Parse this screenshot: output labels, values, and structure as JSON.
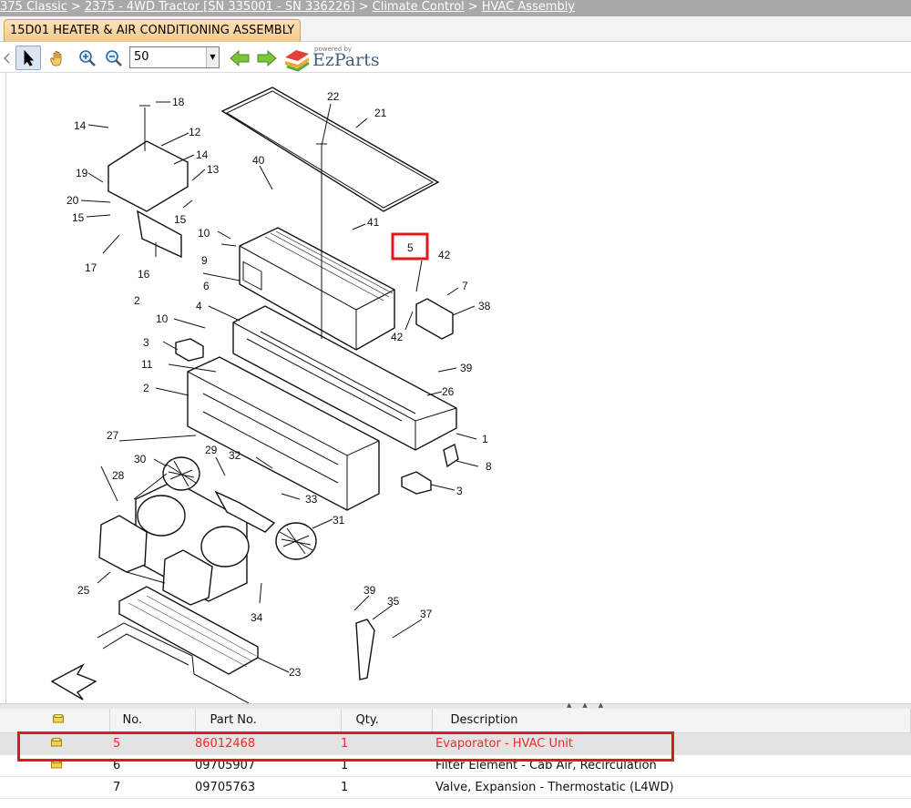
{
  "breadcrumb": {
    "items": [
      "375 Classic",
      "2375 - 4WD Tractor [SN 335001 - SN 336226]",
      "Climate Control",
      "HVAC Assembly"
    ],
    "separator": ">"
  },
  "tab": {
    "label": "15D01 HEATER & AIR CONDITIONING ASSEMBLY"
  },
  "toolbar": {
    "zoom_value": "50",
    "logo_powered": "powered by",
    "logo_word": "EzParts",
    "icons": [
      "pointer-icon",
      "hand-icon",
      "zoom-in-icon",
      "zoom-out-icon",
      "back-arrow-icon",
      "forward-arrow-icon",
      "ezparts-logo-icon"
    ]
  },
  "diagram": {
    "callouts": [
      "18",
      "14",
      "12",
      "14",
      "13",
      "19",
      "20",
      "15",
      "15",
      "17",
      "16",
      "2",
      "22",
      "21",
      "40",
      "41",
      "10",
      "9",
      "6",
      "5",
      "42",
      "7",
      "38",
      "4",
      "10",
      "3",
      "42",
      "11",
      "39",
      "26",
      "2",
      "1",
      "8",
      "27",
      "30",
      "29",
      "32",
      "33",
      "28",
      "3",
      "31",
      "25",
      "34",
      "39",
      "35",
      "37",
      "23"
    ],
    "highlighted_callout": "5"
  },
  "table": {
    "columns": [
      "",
      "No.",
      "Part No.",
      "Qty.",
      "Description"
    ],
    "rows": [
      {
        "no": "5",
        "part": "86012468",
        "qty": "1",
        "desc": "Evaporator - HVAC Unit",
        "selected": true
      },
      {
        "no": "6",
        "part": "09705907",
        "qty": "1",
        "desc": "Filter Element - Cab Air, Recirculation",
        "selected": false
      },
      {
        "no": "7",
        "part": "09705763",
        "qty": "1",
        "desc": "Valve, Expansion - Thermostatic (L4WD)",
        "selected": false
      }
    ]
  },
  "colors": {
    "highlight": "#e3181d",
    "selected_text": "#ee2b2b",
    "tab_bg": "#f3c98a",
    "breadcrumb_bg": "#a9a9a9"
  }
}
